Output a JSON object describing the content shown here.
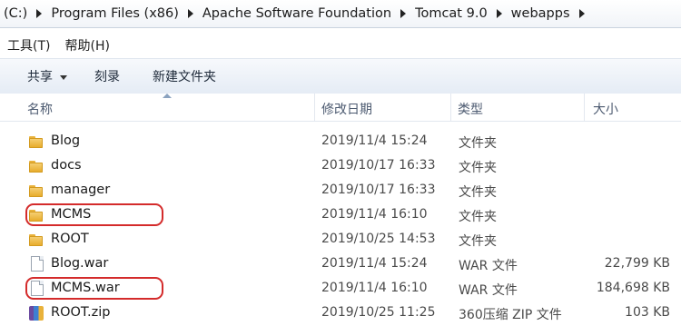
{
  "address": {
    "segments": [
      "(C:)",
      "Program Files (x86)",
      "Apache Software Foundation",
      "Tomcat 9.0",
      "webapps"
    ]
  },
  "menu": {
    "tools": "工具(T)",
    "help": "帮助(H)"
  },
  "toolbar": {
    "share": "共享",
    "burn": "刻录",
    "new_folder": "新建文件夹"
  },
  "columns": {
    "name": "名称",
    "date": "修改日期",
    "type": "类型",
    "size": "大小"
  },
  "files": [
    {
      "name": "Blog",
      "date": "2019/11/4 15:24",
      "type": "文件夹",
      "size": "",
      "icon": "folder-icon"
    },
    {
      "name": "docs",
      "date": "2019/10/17 16:33",
      "type": "文件夹",
      "size": "",
      "icon": "folder-icon"
    },
    {
      "name": "manager",
      "date": "2019/10/17 16:33",
      "type": "文件夹",
      "size": "",
      "icon": "folder-icon"
    },
    {
      "name": "MCMS",
      "date": "2019/11/4 16:10",
      "type": "文件夹",
      "size": "",
      "icon": "folder-icon",
      "highlighted": true
    },
    {
      "name": "ROOT",
      "date": "2019/10/25 14:53",
      "type": "文件夹",
      "size": "",
      "icon": "folder-icon"
    },
    {
      "name": "Blog.war",
      "date": "2019/11/4 15:24",
      "type": "WAR 文件",
      "size": "22,799 KB",
      "icon": "file-icon"
    },
    {
      "name": "MCMS.war",
      "date": "2019/11/4 16:10",
      "type": "WAR 文件",
      "size": "184,698 KB",
      "icon": "file-icon",
      "highlighted": true
    },
    {
      "name": "ROOT.zip",
      "date": "2019/10/25 11:25",
      "type": "360压缩 ZIP 文件",
      "size": "103 KB",
      "icon": "zip-icon"
    }
  ],
  "colors": {
    "annotation": "#d42b2b",
    "folder": "#e6a925"
  }
}
